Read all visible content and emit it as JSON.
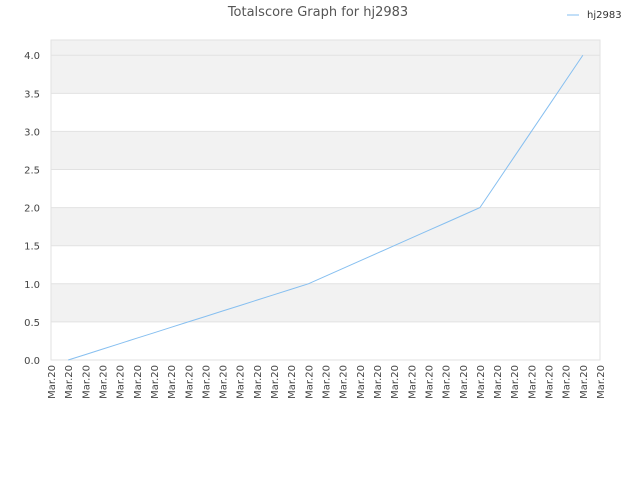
{
  "chart_data": {
    "type": "line",
    "title": "Totalscore Graph for hj2983",
    "xlabel": "",
    "ylabel": "",
    "ylim": [
      0,
      4.2
    ],
    "yticks": [
      "0.0",
      "0.5",
      "1.0",
      "1.5",
      "2.0",
      "2.5",
      "3.0",
      "3.5",
      "4.0"
    ],
    "categories": [
      "Mar.20",
      "Mar.20",
      "Mar.20",
      "Mar.20",
      "Mar.20",
      "Mar.20",
      "Mar.20",
      "Mar.20",
      "Mar.20",
      "Mar.20",
      "Mar.20",
      "Mar.20",
      "Mar.20",
      "Mar.20",
      "Mar.20",
      "Mar.20",
      "Mar.20",
      "Mar.20",
      "Mar.20",
      "Mar.20",
      "Mar.20",
      "Mar.20",
      "Mar.20",
      "Mar.20",
      "Mar.20",
      "Mar.20",
      "Mar.20",
      "Mar.20",
      "Mar.20",
      "Mar.20",
      "Mar.20",
      "Mar.20",
      "Mar.20"
    ],
    "series": [
      {
        "name": "hj2983",
        "color": "#86bff0",
        "values": [
          null,
          0.0,
          0.071,
          0.143,
          0.214,
          0.286,
          0.357,
          0.429,
          0.5,
          0.571,
          0.643,
          0.714,
          0.786,
          0.857,
          0.929,
          1.0,
          1.1,
          1.2,
          1.3,
          1.4,
          1.5,
          1.6,
          1.7,
          1.8,
          1.9,
          2.0,
          2.333,
          2.667,
          3.0,
          3.333,
          3.667,
          4.0,
          null
        ]
      }
    ],
    "grid": true,
    "legend": "top-right"
  }
}
